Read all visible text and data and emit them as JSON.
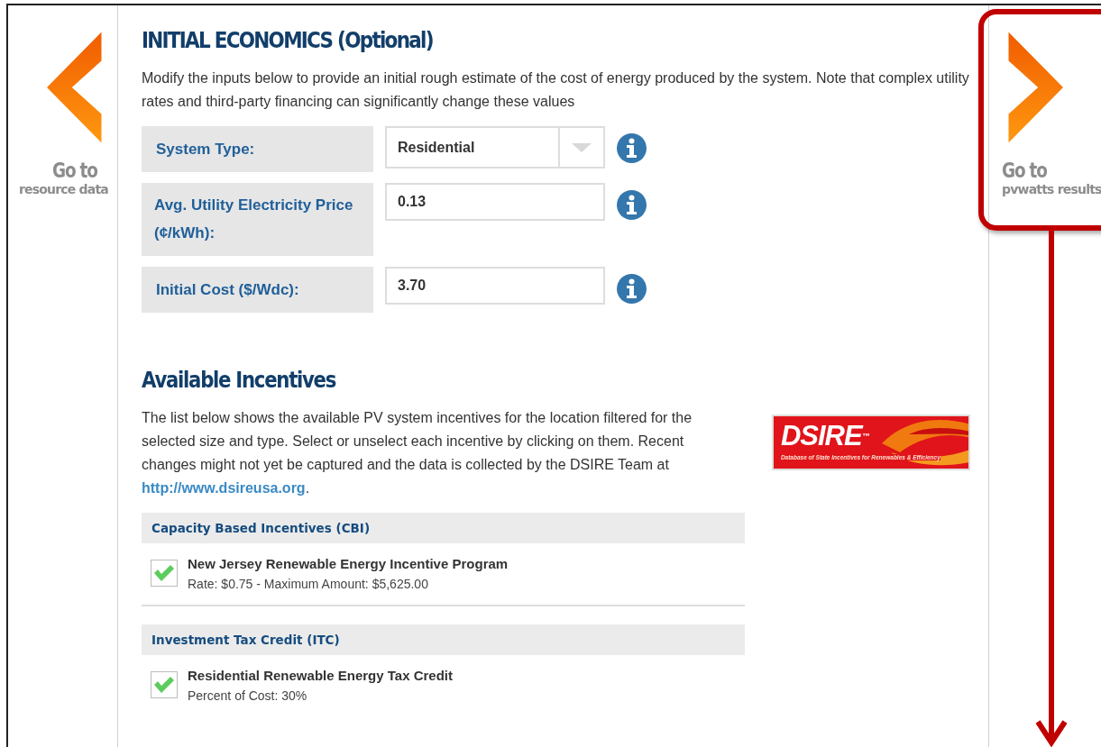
{
  "nav_prev": {
    "title": "Go to",
    "subtitle": "resource data"
  },
  "section_title": "INITIAL ECONOMICS (Optional)",
  "intro": "Modify the inputs below to provide an initial rough estimate of the cost of energy produced by the system. Note that complex utility rates and third-party financing can significantly change these values",
  "fields": [
    {
      "kind": "select",
      "label": "System Type:",
      "value": "Residential"
    },
    {
      "kind": "text",
      "label": "Avg. Utility Electricity Price (¢/kWh):",
      "value": "0.13"
    },
    {
      "kind": "text",
      "label": "Initial Cost ($/Wdc):",
      "value": "3.70"
    }
  ],
  "incentives_title": "Available Incentives",
  "incentives_intro": "The list below shows the available PV system incentives for the location filtered for the selected size and type. Select or unselect each incentive by clicking on them. Recent changes might not yet be captured and the data is collected by the DSIRE Team at",
  "incentives_link": "http://www.dsireusa.org",
  "incentives_end": ".",
  "dsire_logo": {
    "name": "DSIRE",
    "mark": "™",
    "tagline": "Database of State Incentives for Renewables & Efficiency"
  },
  "groups": [
    {
      "title": "Capacity Based Incentives (CBI)",
      "items": [
        {
          "name": "New Jersey Renewable Energy Incentive Program",
          "detail": "Rate: $0.75 - Maximum Amount: $5,625.00",
          "checked": true
        }
      ]
    },
    {
      "title": "Investment Tax Credit (ITC)",
      "items": [
        {
          "name": "Residential Renewable Energy Tax Credit",
          "detail": "Percent of Cost: 30%",
          "checked": true
        }
      ]
    }
  ],
  "nav_next": {
    "title": "Go to",
    "subtitle": "pvwatts results"
  }
}
